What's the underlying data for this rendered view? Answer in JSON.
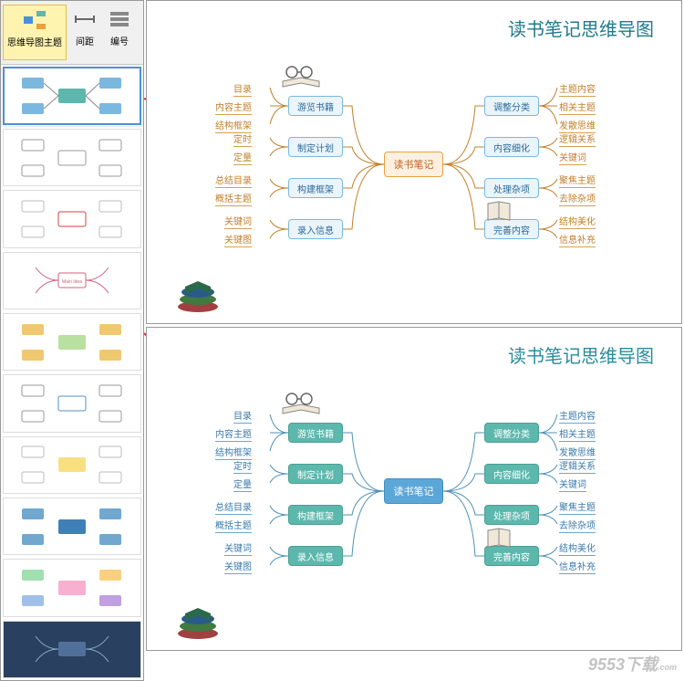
{
  "ribbon": {
    "items": [
      {
        "label": "思维导图主题",
        "active": true
      },
      {
        "label": "间距",
        "active": false
      },
      {
        "label": "编号",
        "active": false
      }
    ]
  },
  "templates": [
    {
      "id": 0,
      "selected": true,
      "style": "teal-boxes"
    },
    {
      "id": 1,
      "selected": false,
      "style": "outline-gray"
    },
    {
      "id": 2,
      "selected": false,
      "style": "red-center"
    },
    {
      "id": 3,
      "selected": false,
      "style": "pink-center"
    },
    {
      "id": 4,
      "selected": false,
      "style": "green-boxes"
    },
    {
      "id": 5,
      "selected": false,
      "style": "blue-outline"
    },
    {
      "id": 6,
      "selected": false,
      "style": "yellow-center"
    },
    {
      "id": 7,
      "selected": false,
      "style": "blue-solid"
    },
    {
      "id": 8,
      "selected": false,
      "style": "multi-color"
    },
    {
      "id": 9,
      "selected": false,
      "style": "dark-navy"
    }
  ],
  "canvas1": {
    "title": "读书笔记思维导图",
    "center": "读书笔记",
    "left_branches": [
      {
        "node": "游览书籍",
        "leaves": [
          "目录",
          "内容主题",
          "结构框架"
        ]
      },
      {
        "node": "制定计划",
        "leaves": [
          "定时",
          "定量"
        ]
      },
      {
        "node": "构建框架",
        "leaves": [
          "总结目录",
          "概括主题"
        ]
      },
      {
        "node": "录入信息",
        "leaves": [
          "关键词",
          "关键图"
        ]
      }
    ],
    "right_branches": [
      {
        "node": "调整分类",
        "leaves": [
          "主题内容",
          "相关主题",
          "发散思维"
        ]
      },
      {
        "node": "内容细化",
        "leaves": [
          "逻辑关系",
          "关键词"
        ]
      },
      {
        "node": "处理杂项",
        "leaves": [
          "聚焦主题",
          "去除杂项"
        ]
      },
      {
        "node": "完善内容",
        "leaves": [
          "结构美化",
          "信息补充"
        ]
      }
    ]
  },
  "canvas2": {
    "title": "读书笔记思维导图",
    "center": "读书笔记",
    "left_branches": [
      {
        "node": "游览书籍",
        "leaves": [
          "目录",
          "内容主题",
          "结构框架"
        ]
      },
      {
        "node": "制定计划",
        "leaves": [
          "定时",
          "定量"
        ]
      },
      {
        "node": "构建框架",
        "leaves": [
          "总结目录",
          "概括主题"
        ]
      },
      {
        "node": "录入信息",
        "leaves": [
          "关键词",
          "关键图"
        ]
      }
    ],
    "right_branches": [
      {
        "node": "调整分类",
        "leaves": [
          "主题内容",
          "相关主题",
          "发散思维"
        ]
      },
      {
        "node": "内容细化",
        "leaves": [
          "逻辑关系",
          "关键词"
        ]
      },
      {
        "node": "处理杂项",
        "leaves": [
          "聚焦主题",
          "去除杂项"
        ]
      },
      {
        "node": "完善内容",
        "leaves": [
          "结构美化",
          "信息补充"
        ]
      }
    ]
  },
  "watermark": "9553下载",
  "watermark_suffix": ".com"
}
